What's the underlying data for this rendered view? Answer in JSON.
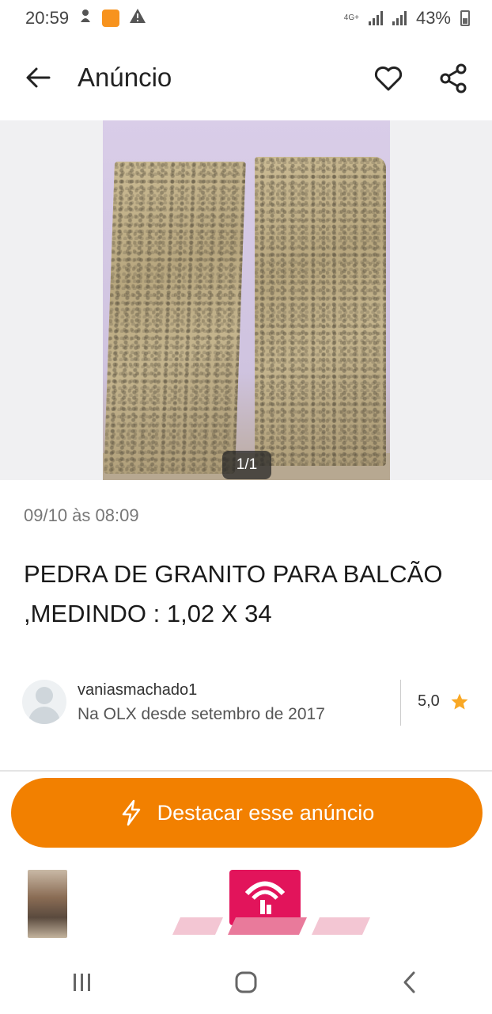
{
  "status_bar": {
    "time": "20:59",
    "network": "4G+",
    "battery": "43%"
  },
  "app_bar": {
    "title": "Anúncio"
  },
  "gallery": {
    "counter": "1/1"
  },
  "ad": {
    "date": "09/10 às 08:09",
    "title": "PEDRA DE GRANITO PARA BALCÃO ,MEDINDO : 1,02 X 34"
  },
  "seller": {
    "name": "vaniasmachado1",
    "since": "Na OLX desde setembro de 2017",
    "rating": "5,0"
  },
  "cta": {
    "label": "Destacar esse anúncio"
  },
  "colors": {
    "accent": "#f28000",
    "star": "#f9a825",
    "banner_brand": "#e2145b"
  }
}
